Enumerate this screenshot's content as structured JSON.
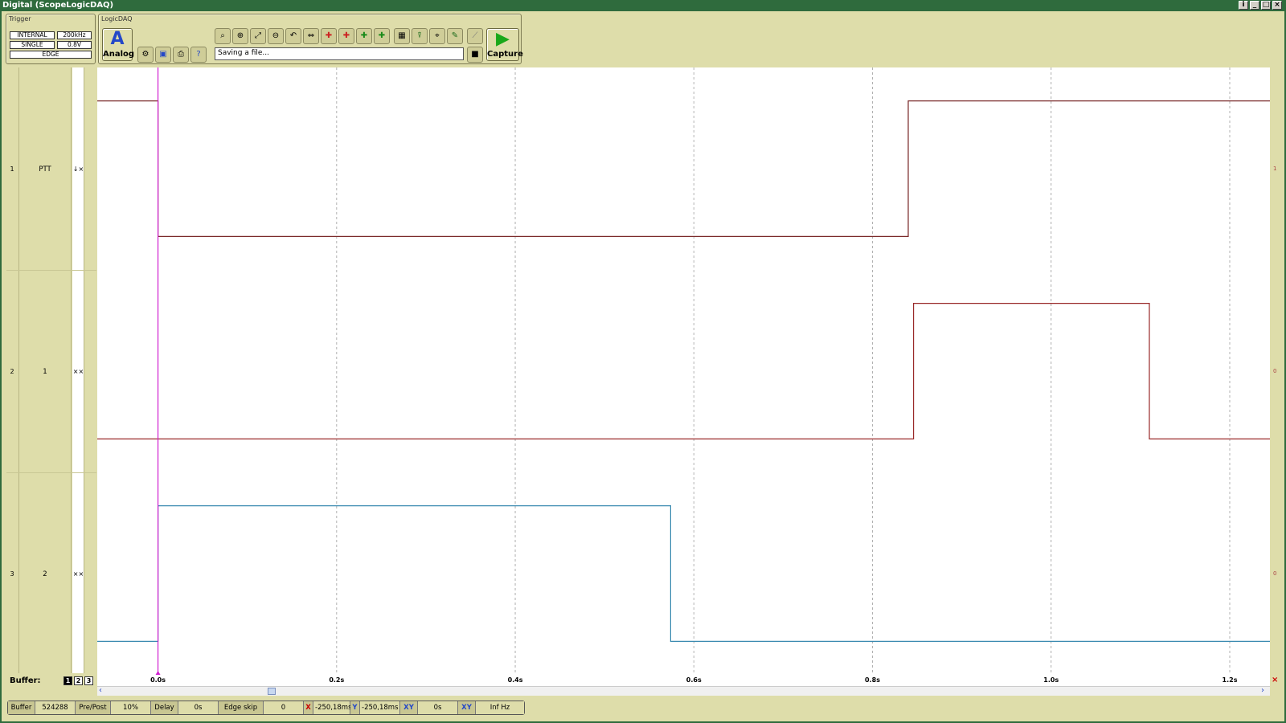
{
  "window": {
    "title": "Digital (ScopeLogicDAQ)",
    "buttons": [
      "i",
      "_",
      "□",
      "×"
    ]
  },
  "trigger": {
    "title": "Trigger",
    "source": "INTERNAL",
    "rate": "200kHz",
    "mode": "SINGLE",
    "level": "0.8V",
    "type": "EDGE"
  },
  "logicdaq": {
    "title": "LogicDAQ",
    "analog_label": "Analog",
    "analog_glyph": "A",
    "capture_label": "Capture",
    "status_text": "Saving a file..."
  },
  "channels": [
    {
      "num": "1",
      "name": "PTT",
      "ctrl": "↓×",
      "right": "1"
    },
    {
      "num": "2",
      "name": "1",
      "ctrl": "××",
      "right": "0"
    },
    {
      "num": "3",
      "name": "2",
      "ctrl": "××",
      "right": "0"
    }
  ],
  "buffer": {
    "label": "Buffer:",
    "options": [
      "1",
      "2",
      "3"
    ],
    "selected": "1"
  },
  "xaxis": {
    "ticks": [
      "0.0s",
      "0.2s",
      "0.4s",
      "0.6s",
      "0.8s",
      "1.0s",
      "1.2s"
    ]
  },
  "statusbar": {
    "buffer_label": "Buffer",
    "buffer_value": "524288",
    "prepost_label": "Pre/Post",
    "prepost_value": "10%",
    "delay_label": "Delay",
    "delay_value": "0s",
    "edgeskip_label": "Edge skip",
    "edgeskip_value": "0",
    "x_label": "X",
    "x_value": "-250,18ms",
    "y_label": "Y",
    "y_value": "-250,18ms",
    "xy_label": "XY",
    "xy_value": "0s",
    "xy2_label": "XY",
    "freq_value": "Inf Hz"
  },
  "colors": {
    "ptt": "#7a2a2a",
    "ch1": "#9a2a2a",
    "ch2": "#3a8ab0",
    "trigger": "#d020d0",
    "grid": "#b0b0b0"
  },
  "chart_data": {
    "type": "line",
    "x_unit": "s",
    "xlim": [
      -0.068,
      1.245
    ],
    "trigger_x": 0.0,
    "series": [
      {
        "name": "PTT",
        "points": [
          [
            -0.068,
            1
          ],
          [
            0.0,
            1
          ],
          [
            0.0,
            0
          ],
          [
            0.84,
            0
          ],
          [
            0.84,
            1
          ],
          [
            1.245,
            1
          ]
        ]
      },
      {
        "name": "1",
        "points": [
          [
            -0.068,
            0
          ],
          [
            0.846,
            0
          ],
          [
            0.846,
            1
          ],
          [
            1.11,
            1
          ],
          [
            1.11,
            0
          ],
          [
            1.245,
            0
          ]
        ]
      },
      {
        "name": "2",
        "points": [
          [
            -0.068,
            0
          ],
          [
            0.0,
            0
          ],
          [
            0.0,
            1
          ],
          [
            0.574,
            1
          ],
          [
            0.574,
            0
          ],
          [
            1.245,
            0
          ]
        ]
      }
    ]
  }
}
